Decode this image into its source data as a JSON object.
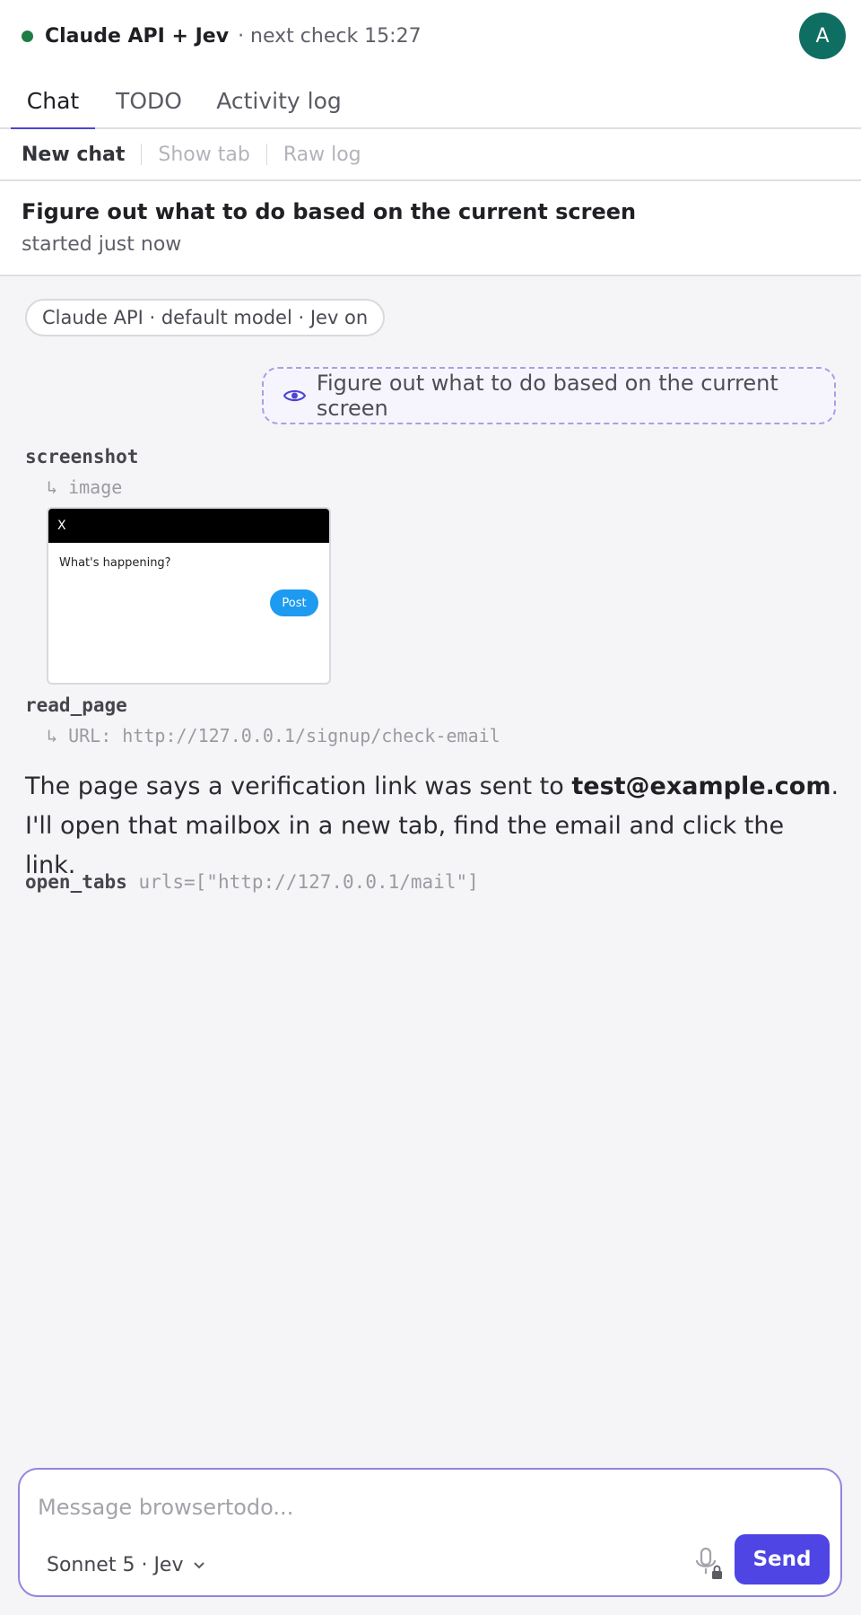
{
  "header": {
    "app_title": "Claude API + Jev",
    "next_check": "· next check 15:27",
    "avatar_initial": "A",
    "status_color": "#1e7d45"
  },
  "tabs": [
    {
      "label": "Chat",
      "active": true
    },
    {
      "label": "TODO",
      "active": false
    },
    {
      "label": "Activity log",
      "active": false
    }
  ],
  "actions": {
    "new_chat": "New chat",
    "show_tab": "Show tab",
    "raw_log": "Raw log"
  },
  "conversation": {
    "title": "Figure out what to do based on the current screen",
    "started": "started just now",
    "model_pill": "Claude API · default model · Jev on",
    "user_message": "Figure out what to do based on the current screen"
  },
  "tool_calls": {
    "screenshot": {
      "name": "screenshot",
      "result": "↳ image",
      "thumbnail": {
        "bar_text": "X",
        "prompt_text": "What's happening?",
        "post_label": "Post"
      }
    },
    "read_page": {
      "name": "read_page",
      "result": "↳ URL: http://127.0.0.1/signup/check-email"
    },
    "open_tabs": {
      "name": "open_tabs",
      "args": "urls=[\"http://127.0.0.1/mail\"]"
    }
  },
  "assistant": {
    "text_before": "The page says a verification link was sent to ",
    "email": "test@example.com",
    "text_after": ". I'll open that mailbox in a new tab, find the email and click the link."
  },
  "composer": {
    "placeholder": "Message browsertodo...",
    "model_label": "Sonnet 5 · Jev",
    "send_label": "Send"
  },
  "colors": {
    "accent": "#4e45e4",
    "avatar_bg": "#0f6e62",
    "status_dot": "#1e7d45"
  }
}
